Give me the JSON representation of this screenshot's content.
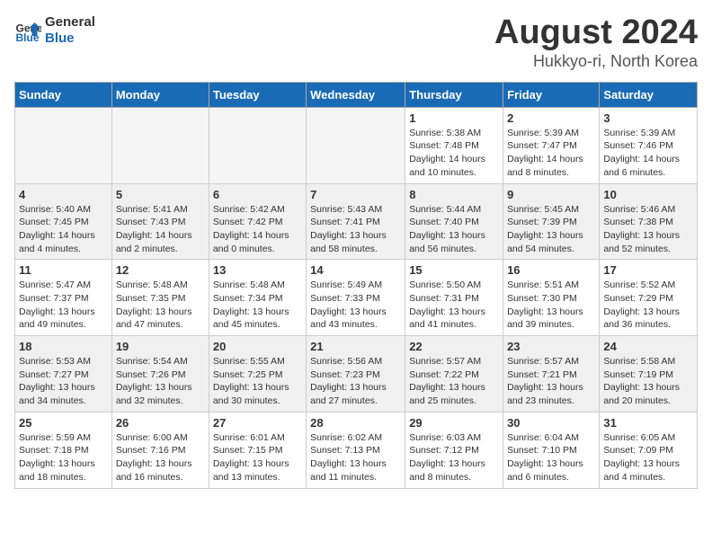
{
  "header": {
    "logo_line1": "General",
    "logo_line2": "Blue",
    "month": "August 2024",
    "location": "Hukkyo-ri, North Korea"
  },
  "weekdays": [
    "Sunday",
    "Monday",
    "Tuesday",
    "Wednesday",
    "Thursday",
    "Friday",
    "Saturday"
  ],
  "weeks": [
    [
      {
        "day": "",
        "info": ""
      },
      {
        "day": "",
        "info": ""
      },
      {
        "day": "",
        "info": ""
      },
      {
        "day": "",
        "info": ""
      },
      {
        "day": "1",
        "info": "Sunrise: 5:38 AM\nSunset: 7:48 PM\nDaylight: 14 hours\nand 10 minutes."
      },
      {
        "day": "2",
        "info": "Sunrise: 5:39 AM\nSunset: 7:47 PM\nDaylight: 14 hours\nand 8 minutes."
      },
      {
        "day": "3",
        "info": "Sunrise: 5:39 AM\nSunset: 7:46 PM\nDaylight: 14 hours\nand 6 minutes."
      }
    ],
    [
      {
        "day": "4",
        "info": "Sunrise: 5:40 AM\nSunset: 7:45 PM\nDaylight: 14 hours\nand 4 minutes."
      },
      {
        "day": "5",
        "info": "Sunrise: 5:41 AM\nSunset: 7:43 PM\nDaylight: 14 hours\nand 2 minutes."
      },
      {
        "day": "6",
        "info": "Sunrise: 5:42 AM\nSunset: 7:42 PM\nDaylight: 14 hours\nand 0 minutes."
      },
      {
        "day": "7",
        "info": "Sunrise: 5:43 AM\nSunset: 7:41 PM\nDaylight: 13 hours\nand 58 minutes."
      },
      {
        "day": "8",
        "info": "Sunrise: 5:44 AM\nSunset: 7:40 PM\nDaylight: 13 hours\nand 56 minutes."
      },
      {
        "day": "9",
        "info": "Sunrise: 5:45 AM\nSunset: 7:39 PM\nDaylight: 13 hours\nand 54 minutes."
      },
      {
        "day": "10",
        "info": "Sunrise: 5:46 AM\nSunset: 7:38 PM\nDaylight: 13 hours\nand 52 minutes."
      }
    ],
    [
      {
        "day": "11",
        "info": "Sunrise: 5:47 AM\nSunset: 7:37 PM\nDaylight: 13 hours\nand 49 minutes."
      },
      {
        "day": "12",
        "info": "Sunrise: 5:48 AM\nSunset: 7:35 PM\nDaylight: 13 hours\nand 47 minutes."
      },
      {
        "day": "13",
        "info": "Sunrise: 5:48 AM\nSunset: 7:34 PM\nDaylight: 13 hours\nand 45 minutes."
      },
      {
        "day": "14",
        "info": "Sunrise: 5:49 AM\nSunset: 7:33 PM\nDaylight: 13 hours\nand 43 minutes."
      },
      {
        "day": "15",
        "info": "Sunrise: 5:50 AM\nSunset: 7:31 PM\nDaylight: 13 hours\nand 41 minutes."
      },
      {
        "day": "16",
        "info": "Sunrise: 5:51 AM\nSunset: 7:30 PM\nDaylight: 13 hours\nand 39 minutes."
      },
      {
        "day": "17",
        "info": "Sunrise: 5:52 AM\nSunset: 7:29 PM\nDaylight: 13 hours\nand 36 minutes."
      }
    ],
    [
      {
        "day": "18",
        "info": "Sunrise: 5:53 AM\nSunset: 7:27 PM\nDaylight: 13 hours\nand 34 minutes."
      },
      {
        "day": "19",
        "info": "Sunrise: 5:54 AM\nSunset: 7:26 PM\nDaylight: 13 hours\nand 32 minutes."
      },
      {
        "day": "20",
        "info": "Sunrise: 5:55 AM\nSunset: 7:25 PM\nDaylight: 13 hours\nand 30 minutes."
      },
      {
        "day": "21",
        "info": "Sunrise: 5:56 AM\nSunset: 7:23 PM\nDaylight: 13 hours\nand 27 minutes."
      },
      {
        "day": "22",
        "info": "Sunrise: 5:57 AM\nSunset: 7:22 PM\nDaylight: 13 hours\nand 25 minutes."
      },
      {
        "day": "23",
        "info": "Sunrise: 5:57 AM\nSunset: 7:21 PM\nDaylight: 13 hours\nand 23 minutes."
      },
      {
        "day": "24",
        "info": "Sunrise: 5:58 AM\nSunset: 7:19 PM\nDaylight: 13 hours\nand 20 minutes."
      }
    ],
    [
      {
        "day": "25",
        "info": "Sunrise: 5:59 AM\nSunset: 7:18 PM\nDaylight: 13 hours\nand 18 minutes."
      },
      {
        "day": "26",
        "info": "Sunrise: 6:00 AM\nSunset: 7:16 PM\nDaylight: 13 hours\nand 16 minutes."
      },
      {
        "day": "27",
        "info": "Sunrise: 6:01 AM\nSunset: 7:15 PM\nDaylight: 13 hours\nand 13 minutes."
      },
      {
        "day": "28",
        "info": "Sunrise: 6:02 AM\nSunset: 7:13 PM\nDaylight: 13 hours\nand 11 minutes."
      },
      {
        "day": "29",
        "info": "Sunrise: 6:03 AM\nSunset: 7:12 PM\nDaylight: 13 hours\nand 8 minutes."
      },
      {
        "day": "30",
        "info": "Sunrise: 6:04 AM\nSunset: 7:10 PM\nDaylight: 13 hours\nand 6 minutes."
      },
      {
        "day": "31",
        "info": "Sunrise: 6:05 AM\nSunset: 7:09 PM\nDaylight: 13 hours\nand 4 minutes."
      }
    ]
  ]
}
